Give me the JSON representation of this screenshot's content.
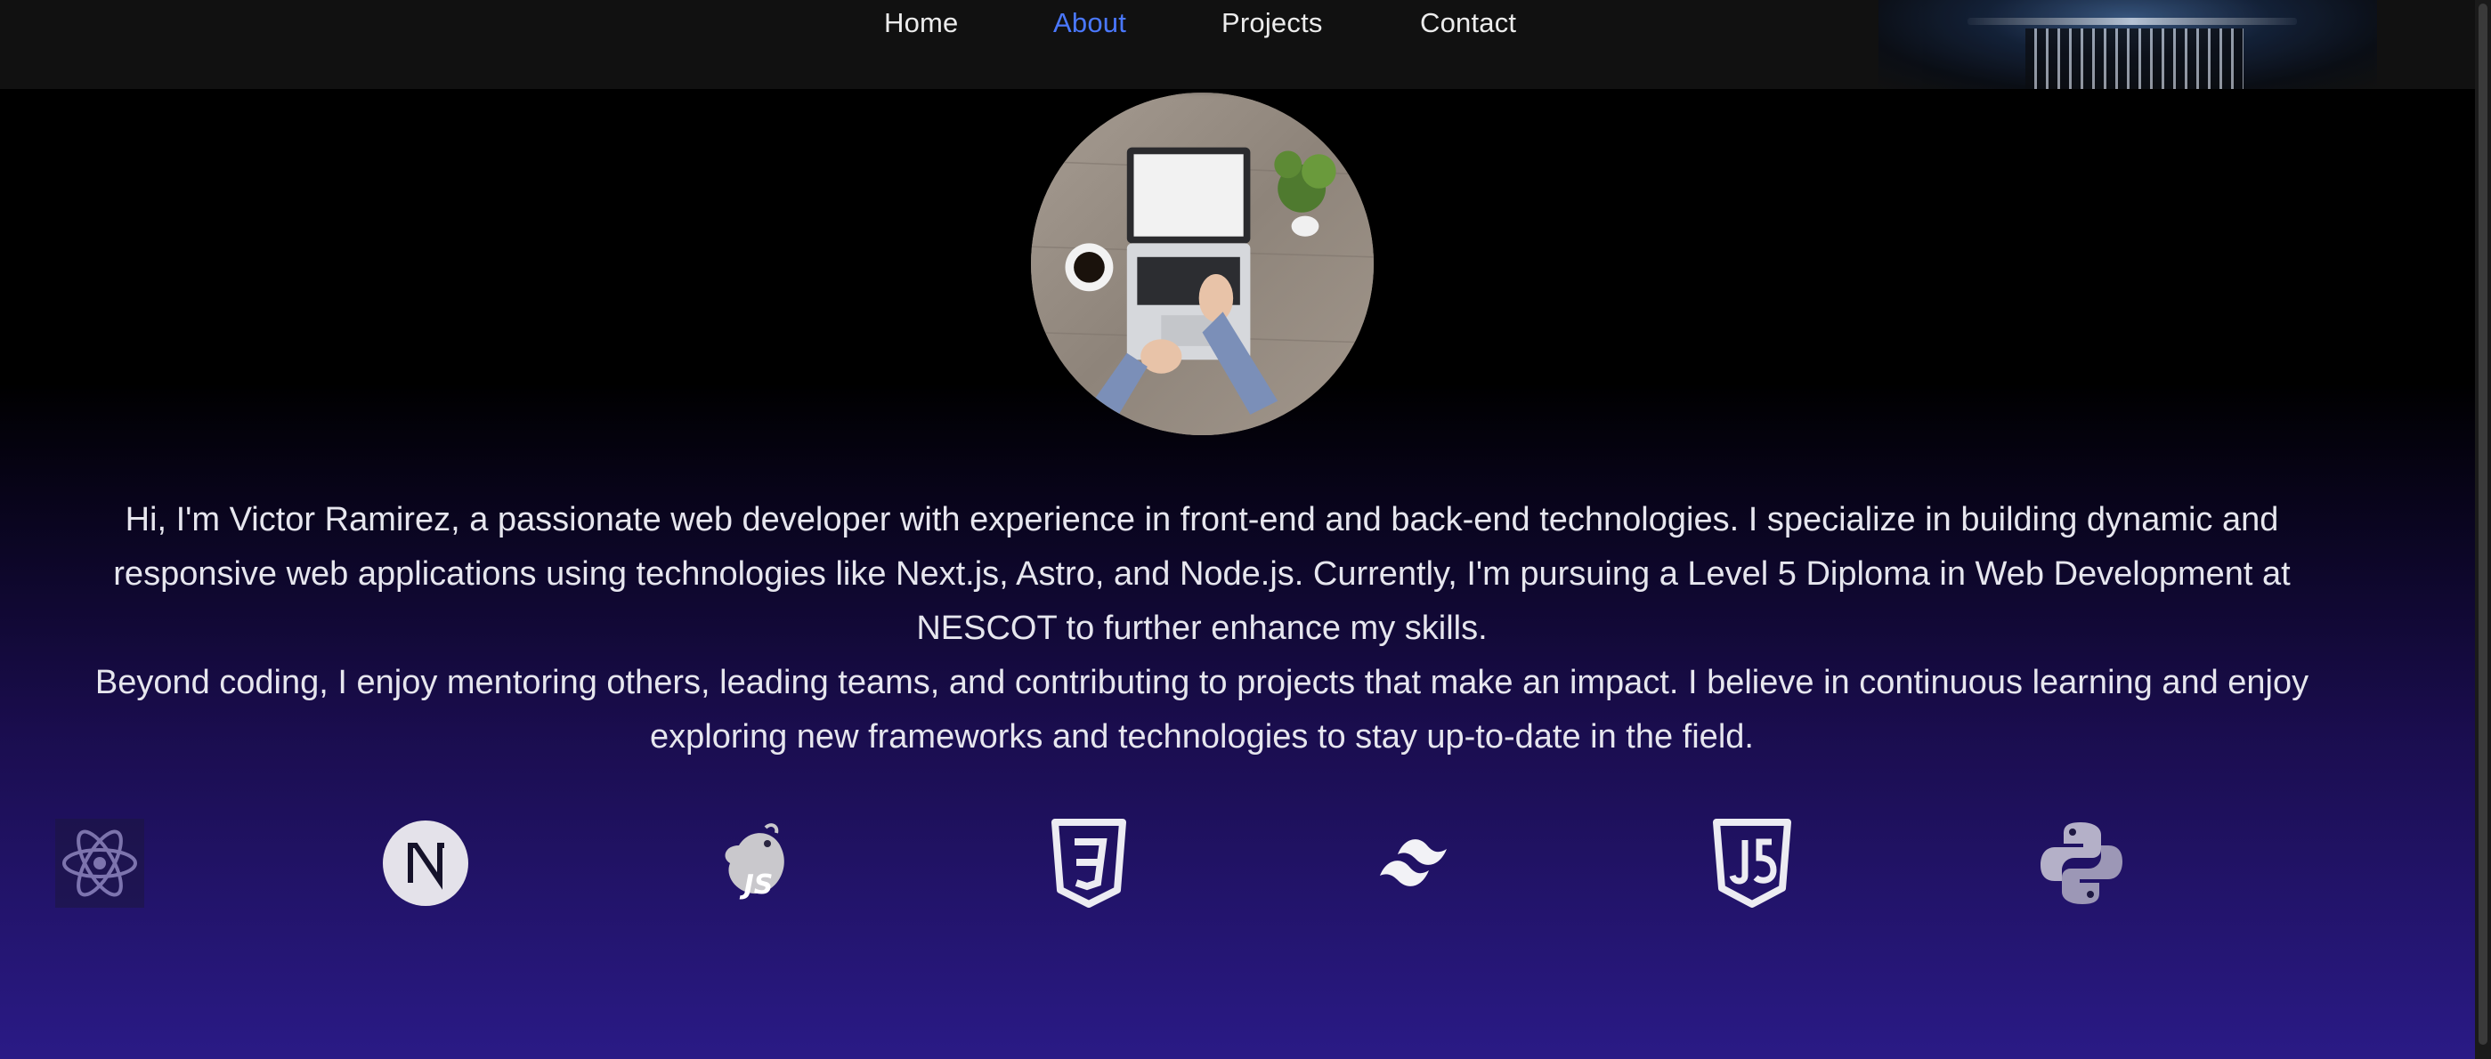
{
  "nav": {
    "items": [
      {
        "label": "Home",
        "active": false
      },
      {
        "label": "About",
        "active": true
      },
      {
        "label": "Projects",
        "active": false
      },
      {
        "label": "Contact",
        "active": false
      }
    ],
    "active_color": "#4a78ff"
  },
  "about": {
    "avatar": "laptop-desk-photo",
    "paragraphs": [
      "Hi, I'm Victor Ramirez, a passionate web developer with experience in front-end and back-end technologies. I specialize in building dynamic and responsive web applications using technologies like Next.js, Astro, and Node.js. Currently, I'm pursuing a Level 5 Diploma in Web Development at NESCOT to further enhance my skills.",
      "Beyond coding, I enjoy mentoring others, leading teams, and contributing to projects that make an impact. I believe in continuous learning and enjoy exploring new frameworks and technologies to stay up-to-date in the field."
    ]
  },
  "tech_icons": [
    {
      "name": "react-icon"
    },
    {
      "name": "nextjs-icon"
    },
    {
      "name": "nestjs-icon"
    },
    {
      "name": "css3-icon"
    },
    {
      "name": "tailwind-icon"
    },
    {
      "name": "javascript-icon"
    },
    {
      "name": "python-icon"
    }
  ],
  "colors": {
    "background_top": "#000000",
    "background_bottom": "#2a1a86",
    "navbar": "#111111",
    "text": "#e6e6ee"
  }
}
